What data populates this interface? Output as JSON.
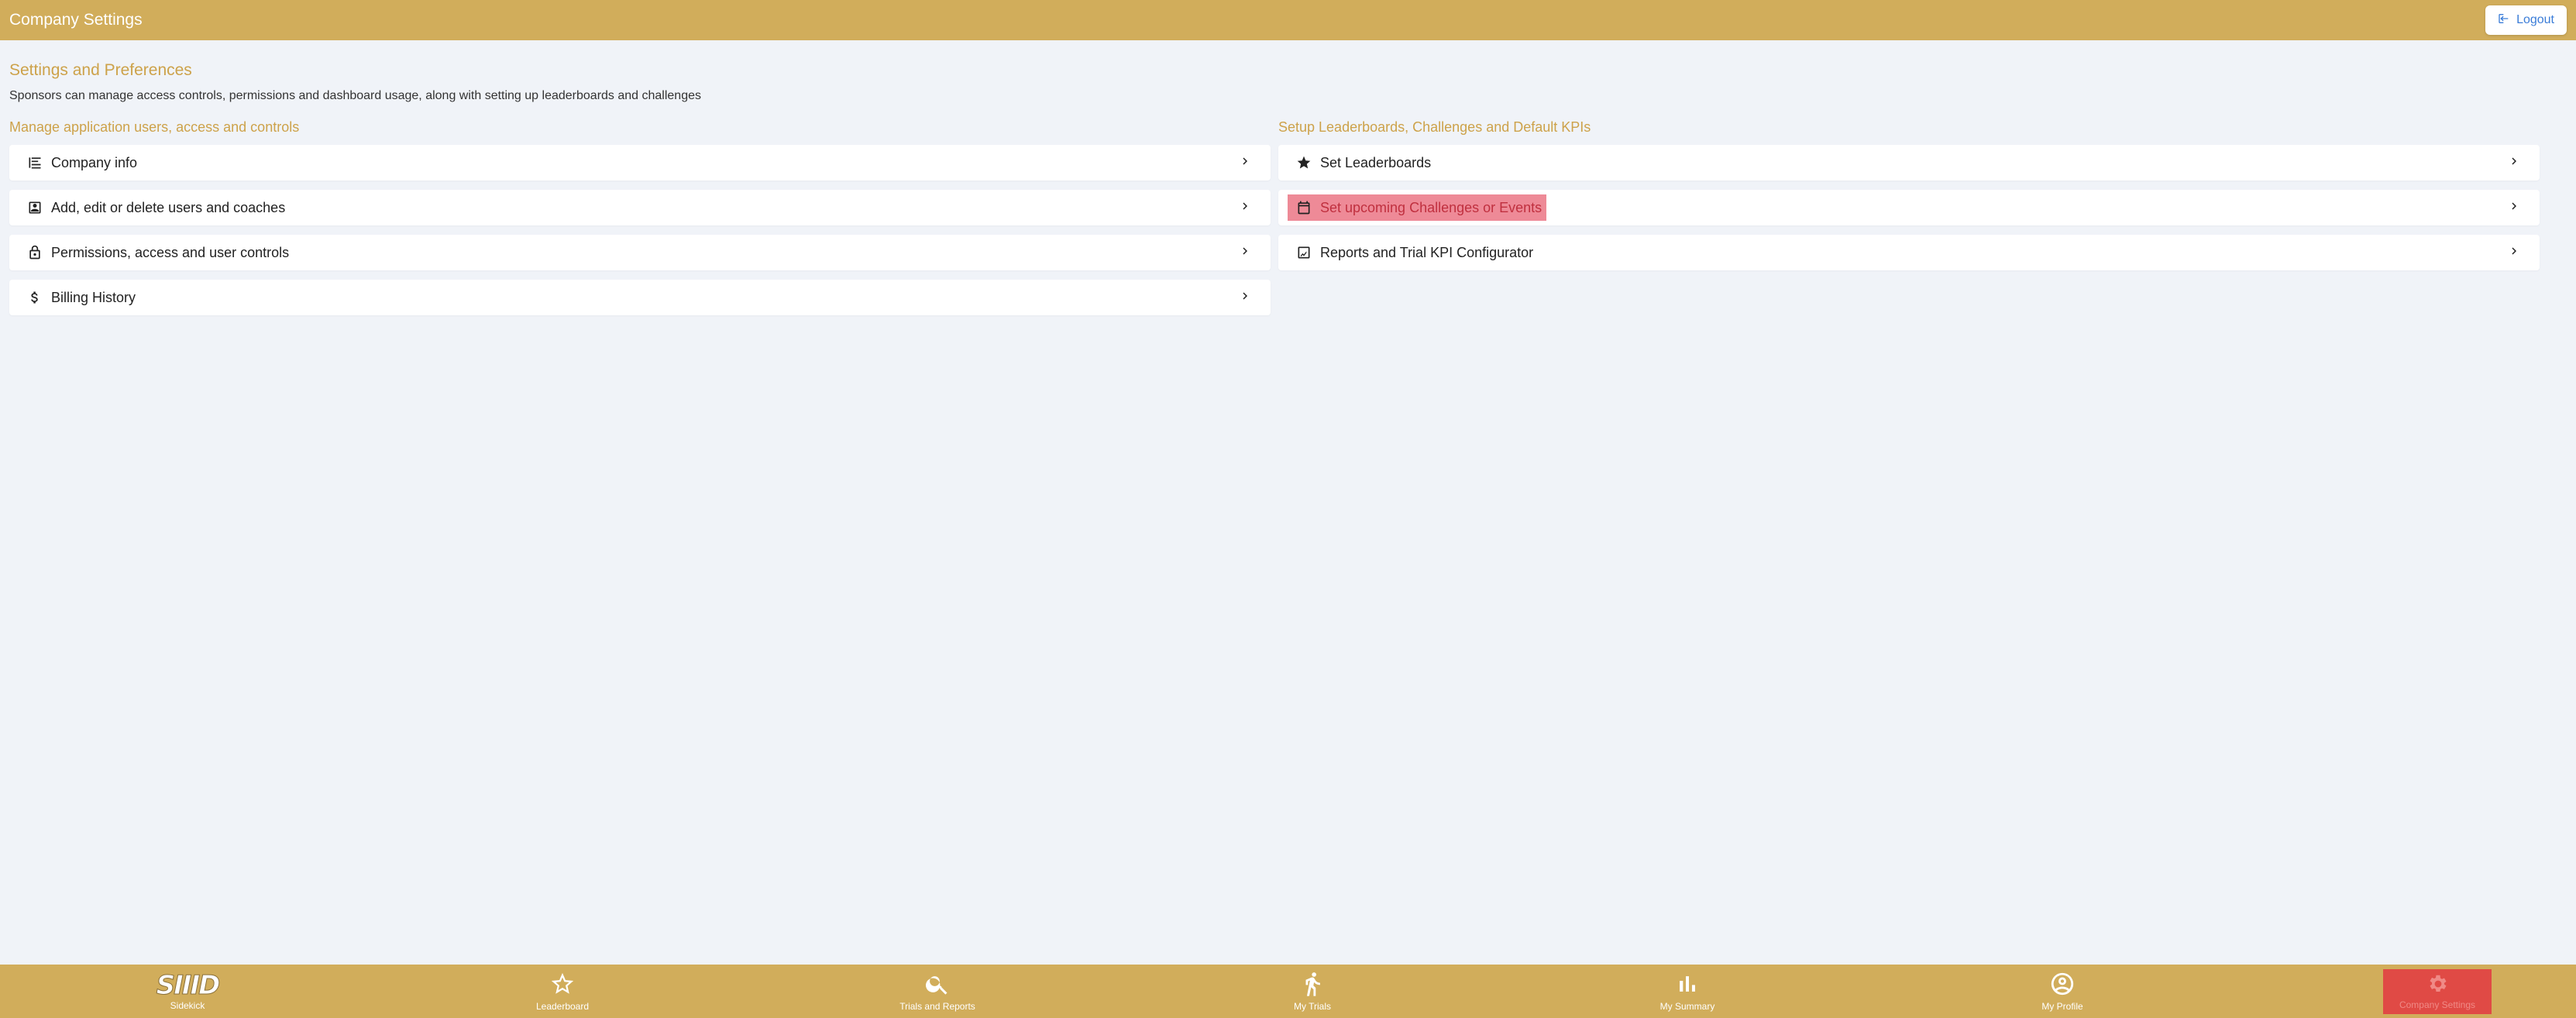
{
  "app": {
    "title": "Company Settings",
    "logout_label": "Logout"
  },
  "page": {
    "heading": "Settings and Preferences",
    "description": "Sponsors can manage access controls, permissions and dashboard usage, along with setting up leaderboards and challenges"
  },
  "left_section": {
    "heading": "Manage application users, access and controls",
    "items": [
      {
        "label": "Company info",
        "icon": "company-list-icon"
      },
      {
        "label": "Add, edit or delete users and  coaches",
        "icon": "user-card-icon"
      },
      {
        "label": "Permissions, access and user controls",
        "icon": "lock-icon"
      },
      {
        "label": "Billing History",
        "icon": "dollar-icon"
      }
    ]
  },
  "right_section": {
    "heading": "Setup Leaderboards, Challenges and Default KPIs",
    "items": [
      {
        "label": "Set  Leaderboards",
        "icon": "star-icon"
      },
      {
        "label": "Set upcoming Challenges or Events",
        "icon": "calendar-icon",
        "highlighted": true
      },
      {
        "label": "Reports and Trial  KPI Configurator",
        "icon": "report-icon"
      }
    ]
  },
  "bottom_nav": {
    "items": [
      {
        "label": "Sidekick",
        "logo_text": "SIIID",
        "icon": "sidekick-logo"
      },
      {
        "label": "Leaderboard",
        "icon": "star-outline-icon"
      },
      {
        "label": "Trials and Reports",
        "icon": "search-icon"
      },
      {
        "label": "My Trials",
        "icon": "runner-icon"
      },
      {
        "label": "My Summary",
        "icon": "bar-chart-icon"
      },
      {
        "label": "My Profile",
        "icon": "profile-icon"
      },
      {
        "label": "Company Settings",
        "icon": "gear-icon",
        "active": true
      }
    ]
  },
  "colors": {
    "brand": "#d1ad5b",
    "heading_accent": "#cda24a",
    "highlight_bg": "#ee8a97",
    "active_nav_bg": "#e04a45",
    "background": "#f0f3f8"
  }
}
